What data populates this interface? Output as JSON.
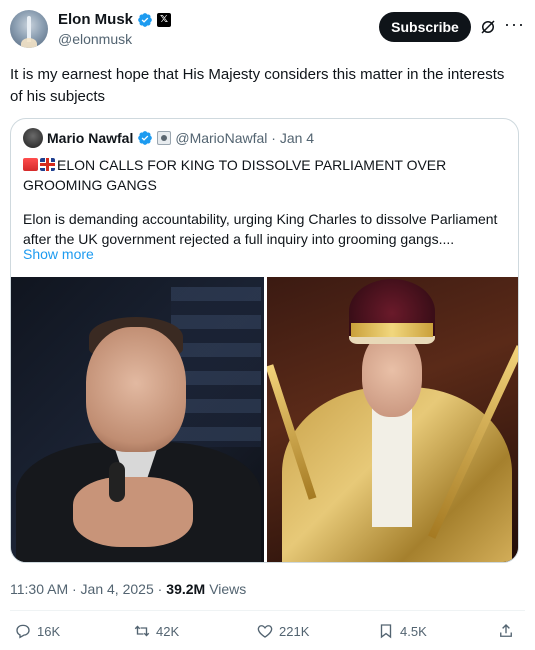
{
  "author": {
    "name": "Elon Musk",
    "handle": "@elonmusk",
    "badge_icon": "verified-badge-icon",
    "affiliation_icon": "x-logo-icon",
    "affiliation_letter": "𝕏"
  },
  "header": {
    "subscribe_label": "Subscribe",
    "grok_icon": "grok-icon",
    "more_icon": "more-dots-icon",
    "more_glyph": "···"
  },
  "tweet": {
    "text": "It is my earnest hope that His Majesty considers this matter in the interests of his subjects"
  },
  "quote": {
    "name": "Mario Nawfal",
    "handle_date": "@MarioNawfal · Jan 4",
    "title": "ELON CALLS FOR KING TO DISSOLVE PARLIAMENT OVER GROOMING GANGS",
    "body": "Elon is demanding accountability, urging King Charles to dissolve Parliament after the UK government rejected a full inquiry into grooming gangs....",
    "show_more": "Show more"
  },
  "meta": {
    "time_date": "11:30 AM · Jan 4, 2025 · ",
    "views_count": "39.2M",
    "views_label": "Views"
  },
  "actions": {
    "replies": "16K",
    "reposts": "42K",
    "likes": "221K",
    "bookmarks": "4.5K"
  },
  "colors": {
    "accent": "#1d9bf0",
    "text": "#0f1419",
    "secondary": "#536471",
    "border": "#cfd9de"
  }
}
